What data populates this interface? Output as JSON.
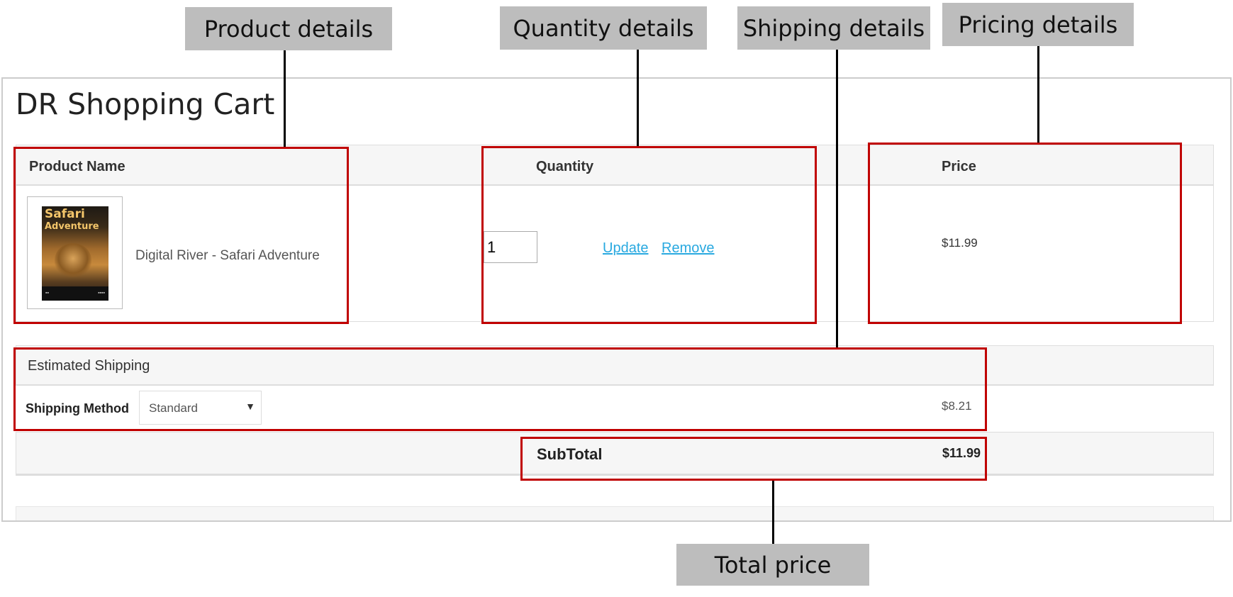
{
  "callouts": {
    "product": "Product details",
    "quantity": "Quantity details",
    "shipping": "Shipping details",
    "pricing": "Pricing details",
    "total": "Total price"
  },
  "cart": {
    "title": "DR Shopping Cart",
    "columns": {
      "product": "Product Name",
      "quantity": "Quantity",
      "price": "Price"
    },
    "item": {
      "cover_title": "Safari",
      "cover_subtitle": "Adventure",
      "name": "Digital River - Safari Adventure",
      "quantity": "1",
      "update_label": "Update",
      "remove_label": "Remove",
      "price": "$11.99"
    },
    "shipping": {
      "heading": "Estimated Shipping",
      "method_label": "Shipping Method",
      "method_value": "Standard",
      "price": "$8.21"
    },
    "subtotal": {
      "label": "SubTotal",
      "value": "$11.99"
    }
  },
  "colors": {
    "highlight": "#c00000",
    "callout_bg": "#bdbdbd",
    "link": "#29a9e0"
  }
}
